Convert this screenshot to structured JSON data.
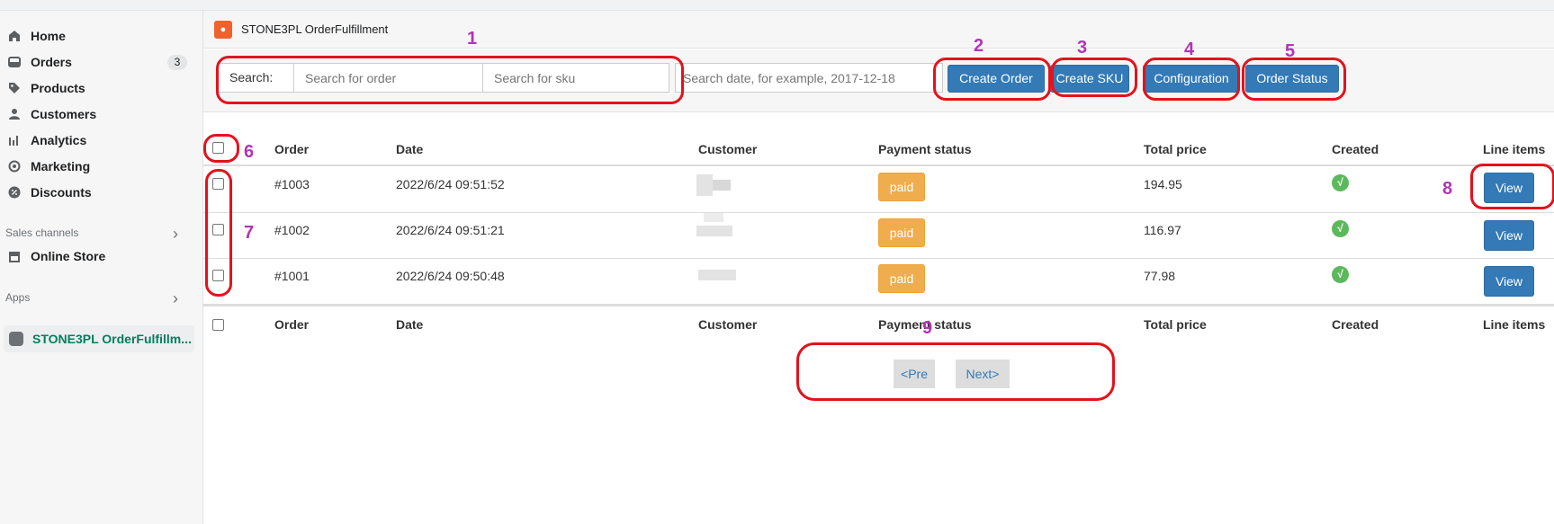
{
  "sidebar": {
    "items": [
      {
        "label": "Home",
        "icon": "home-icon"
      },
      {
        "label": "Orders",
        "icon": "orders-icon",
        "badge": "3"
      },
      {
        "label": "Products",
        "icon": "tag-icon"
      },
      {
        "label": "Customers",
        "icon": "person-icon"
      },
      {
        "label": "Analytics",
        "icon": "bar-chart-icon"
      },
      {
        "label": "Marketing",
        "icon": "target-icon"
      },
      {
        "label": "Discounts",
        "icon": "discount-icon"
      }
    ],
    "sales_channels_title": "Sales channels",
    "online_store": "Online Store",
    "apps_title": "Apps",
    "active_app": "STONE3PL OrderFulfillm..."
  },
  "app": {
    "title": "STONE3PL OrderFulfillment"
  },
  "toolbar": {
    "search_label": "Search:",
    "order_placeholder": "Search for order",
    "sku_placeholder": "Search for sku",
    "date_placeholder": "Search date, for example, 2017-12-18",
    "create_order": "Create Order",
    "create_sku": "Create SKU",
    "configuration": "Configuration",
    "order_status": "Order Status"
  },
  "table": {
    "columns": [
      "Order",
      "Date",
      "Customer",
      "Payment status",
      "Total price",
      "Created",
      "Line items"
    ],
    "rows": [
      {
        "order": "#1003",
        "date": "2022/6/24 09:51:52",
        "payment": "paid",
        "total": "194.95",
        "created": "√",
        "action": "View"
      },
      {
        "order": "#1002",
        "date": "2022/6/24 09:51:21",
        "payment": "paid",
        "total": "116.97",
        "created": "√",
        "action": "View"
      },
      {
        "order": "#1001",
        "date": "2022/6/24 09:50:48",
        "payment": "paid",
        "total": "77.98",
        "created": "√",
        "action": "View"
      }
    ]
  },
  "pagination": {
    "prev": "<Pre",
    "next": "Next>"
  },
  "annotations": [
    "1",
    "2",
    "3",
    "4",
    "5",
    "6",
    "7",
    "8",
    "9"
  ],
  "colors": {
    "primary": "#337ab7",
    "paid": "#f0ad4e",
    "created": "#5cb85c",
    "annotation_outline": "#e3121c",
    "annotation_number": "#b134b5",
    "active_app_text": "#008060"
  }
}
